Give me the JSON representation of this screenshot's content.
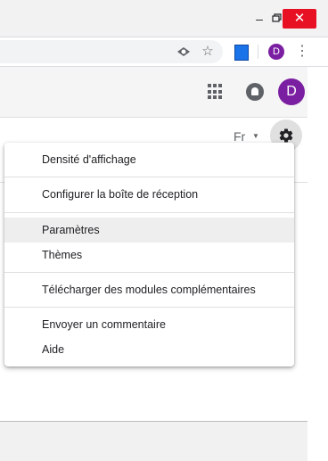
{
  "window_controls": {
    "minimize": "–",
    "close": "✕"
  },
  "browser": {
    "profile_initial": "D",
    "kebab": "⋮",
    "icons": [
      "eye-icon",
      "star-icon",
      "extension-icon",
      "more-vert-icon"
    ]
  },
  "header": {
    "avatar_initial": "D",
    "avatar_color": "#7b1fa2",
    "icons": [
      "apps-icon",
      "notifications-icon"
    ]
  },
  "toolbar": {
    "language": "Fr",
    "settings_icon": "gear-icon"
  },
  "menu": {
    "items": [
      "Densité d'affichage",
      "Configurer la boîte de réception",
      "Paramètres",
      "Thèmes",
      "Télécharger des modules complémentaires",
      "Envoyer un commentaire",
      "Aide"
    ],
    "highlighted": "Paramètres"
  },
  "colors": {
    "close_button": "#e81123",
    "accent_purple": "#7b1fa2"
  }
}
